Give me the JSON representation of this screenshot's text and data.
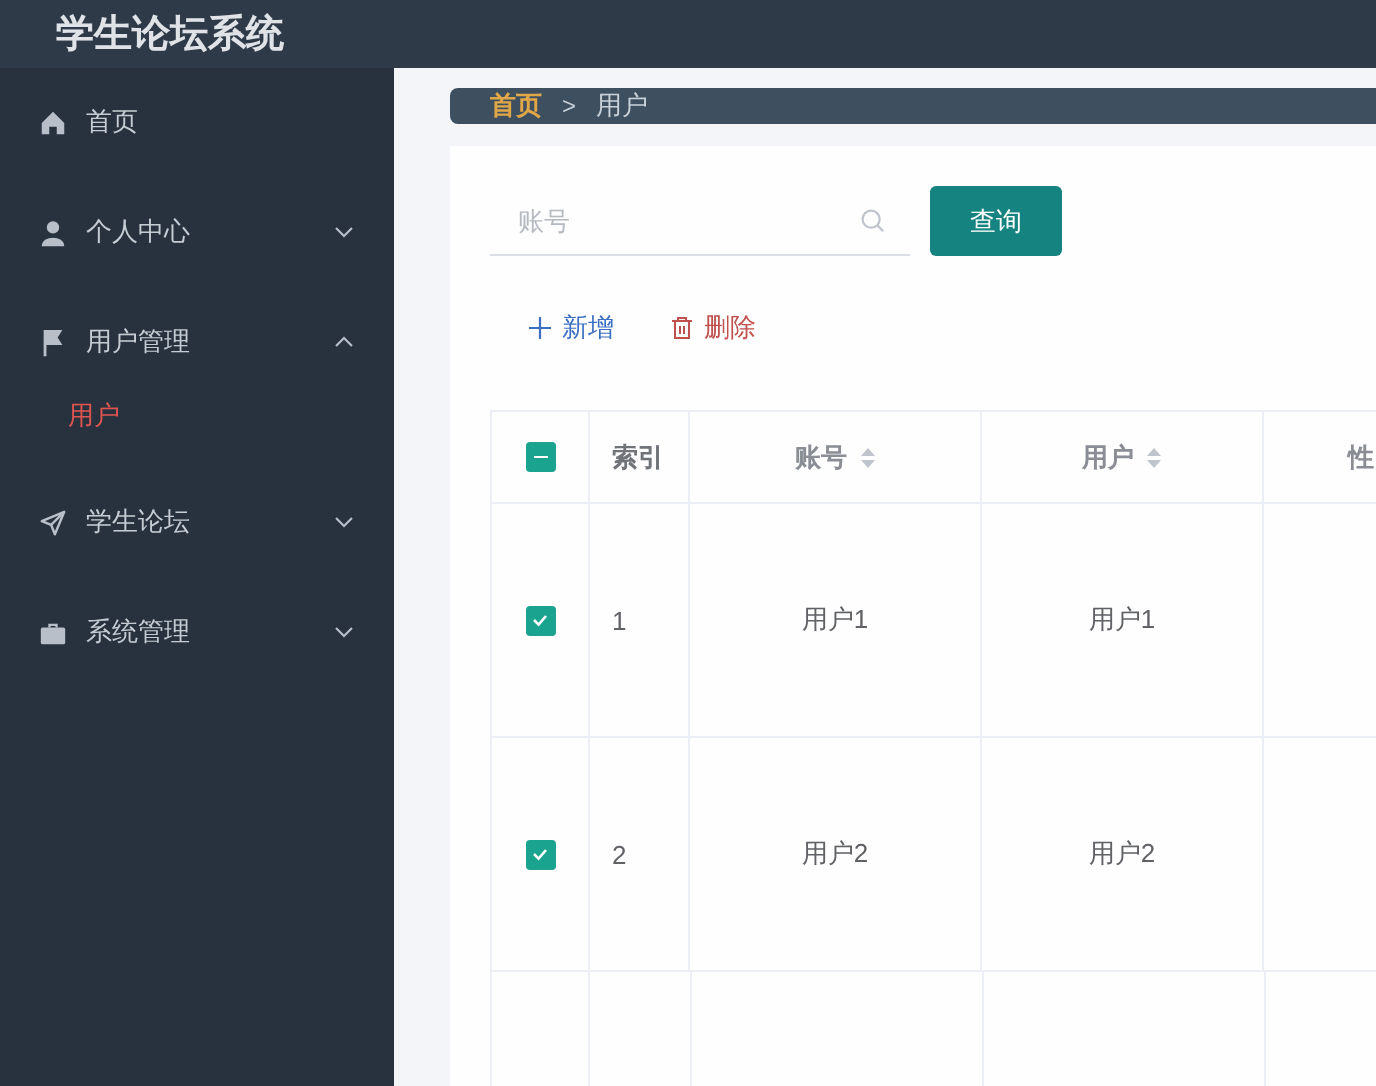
{
  "header": {
    "title": "学生论坛系统"
  },
  "sidebar": {
    "items": [
      {
        "kind": "link",
        "label": "首页"
      },
      {
        "kind": "group",
        "label": "个人中心",
        "expanded": false
      },
      {
        "kind": "group",
        "label": "用户管理",
        "expanded": true,
        "children": [
          {
            "label": "用户",
            "selected": true
          }
        ]
      },
      {
        "kind": "group",
        "label": "学生论坛",
        "expanded": false
      },
      {
        "kind": "group",
        "label": "系统管理",
        "expanded": false
      }
    ]
  },
  "breadcrumb": [
    {
      "label": "首页",
      "current": false
    },
    {
      "label": "用户",
      "current": true
    }
  ],
  "breadcrumb_separator": ">",
  "search": {
    "placeholder": "账号",
    "button": "查询"
  },
  "actions": [
    {
      "kind": "add",
      "label": "新增"
    },
    {
      "kind": "delete",
      "label": "删除"
    }
  ],
  "table": {
    "select_all": {
      "indeterminate": true
    },
    "columns": [
      {
        "label": "索引",
        "sortable": false
      },
      {
        "label": "账号",
        "sortable": true
      },
      {
        "label": "用户",
        "sortable": true
      },
      {
        "label": "性"
      }
    ],
    "rows": [
      {
        "checked": true,
        "cells": [
          "1",
          "用户1",
          "用户1",
          ""
        ]
      },
      {
        "checked": true,
        "cells": [
          "2",
          "用户2",
          "用户2",
          ""
        ]
      }
    ]
  }
}
